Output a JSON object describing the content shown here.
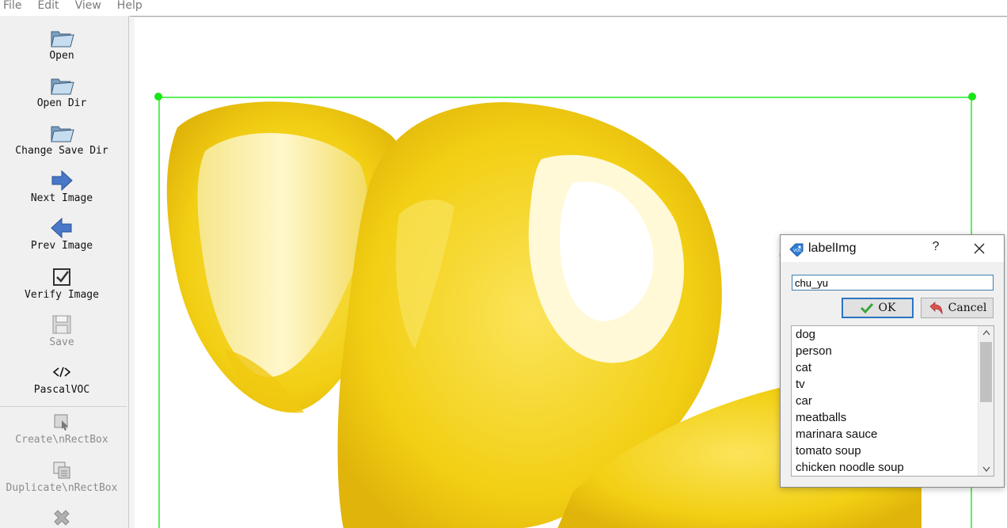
{
  "menu": [
    "File",
    "Edit",
    "View",
    "Help"
  ],
  "toolbar": {
    "open": "Open",
    "open_dir": "Open Dir",
    "change_save_dir": "Change Save Dir",
    "next_image": "Next Image",
    "prev_image": "Prev Image",
    "verify_image": "Verify Image",
    "save": "Save",
    "format": "PascalVOC",
    "create_rectbox": "Create\\nRectBox",
    "duplicate_rectbox": "Duplicate\\nRectBox"
  },
  "dialog": {
    "title": "labelImg",
    "help": "?",
    "input_value": "chu_yu",
    "ok_label": "OK",
    "cancel_label": "Cancel",
    "labels": [
      "dog",
      "person",
      "cat",
      "tv",
      "car",
      "meatballs",
      "marinara sauce",
      "tomato soup",
      "chicken noodle soup"
    ]
  },
  "colors": {
    "bbox": "#5cf05c",
    "handle": "#19e519",
    "lemon": "#f2d21a",
    "input_border": "#3c7fb1"
  },
  "icons": [
    "folder-open-icon",
    "arrow-right-icon",
    "arrow-left-icon",
    "checkbox-icon",
    "floppy-icon",
    "code-icon",
    "rect-icon",
    "duplicate-icon",
    "delete-icon",
    "tag-icon",
    "close-icon",
    "check-icon",
    "undo-icon"
  ]
}
